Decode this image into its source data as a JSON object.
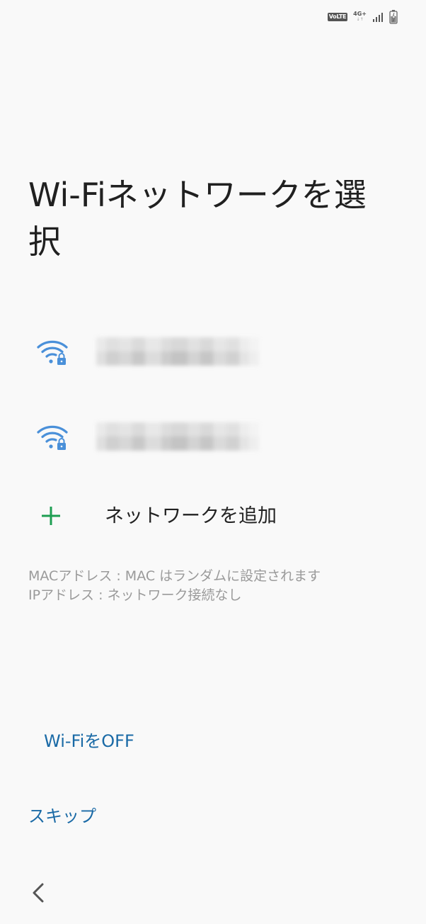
{
  "status_bar": {
    "volte": "VoLTE",
    "network": "4G+",
    "network_arrows": "↓↑",
    "icons": [
      "volte-icon",
      "network-type-icon",
      "signal-icon",
      "battery-charging-icon"
    ]
  },
  "page": {
    "title": "Wi-Fiネットワークを選択"
  },
  "networks": [
    {
      "icon": "wifi-locked-icon",
      "signal_level": 3,
      "secured": true
    },
    {
      "icon": "wifi-locked-icon",
      "signal_level": 3,
      "secured": true
    }
  ],
  "add_network": {
    "icon": "plus-icon",
    "label": "ネットワークを追加"
  },
  "info": {
    "mac": "MACアドレス : MAC はランダムに設定されます",
    "ip": "IPアドレス : ネットワーク接続なし"
  },
  "actions": {
    "wifi_off": "Wi-FiをOFF",
    "skip": "スキップ"
  },
  "nav": {
    "back_icon": "back-chevron-icon"
  },
  "colors": {
    "background": "#f9f9f9",
    "wifi_icon": "#4a90d9",
    "add_icon": "#1e9e52",
    "link": "#1a6aa6",
    "info_text": "#9a9a9a"
  }
}
